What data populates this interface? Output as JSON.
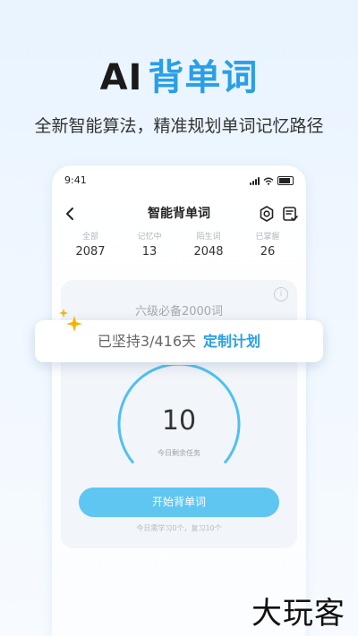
{
  "hero": {
    "title_prefix": "AI",
    "title_main": "背单词",
    "subtitle": "全新智能算法，精准规划单词记忆路径"
  },
  "status_bar": {
    "time": "9:41"
  },
  "nav": {
    "title": "智能背单词"
  },
  "stats": [
    {
      "label": "全部",
      "value": "2087"
    },
    {
      "label": "记忆中",
      "value": "13"
    },
    {
      "label": "陌生词",
      "value": "2048"
    },
    {
      "label": "已掌握",
      "value": "26"
    }
  ],
  "card": {
    "book_name": "六级必备2000词",
    "info_glyph": "i"
  },
  "banner": {
    "progress_text": "已坚持3/416天",
    "link_label": "定制计划"
  },
  "gauge": {
    "remaining": "10",
    "caption": "今日剩余任务"
  },
  "start_button": {
    "label": "开始背单词"
  },
  "hint": "今日需学习0个，复习10个",
  "watermark": "大玩客",
  "colors": {
    "accent": "#2a9fe8",
    "button": "#5fc6f2",
    "gauge": "#4fc0f2",
    "sparkle": "#f5b400"
  }
}
